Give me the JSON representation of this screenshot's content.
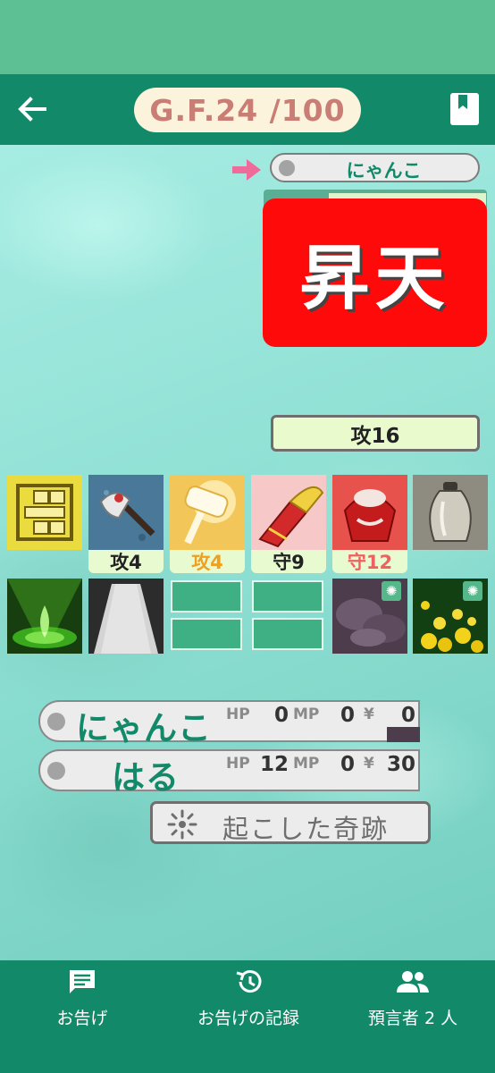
{
  "header": {
    "gf_counter": "G.F.24 /100",
    "back_icon": "arrow-left-icon",
    "bookmark_icon": "bookmark-icon"
  },
  "opponent": {
    "name": "にゃんこ",
    "status_banner": "昇天",
    "attack_total": "攻16"
  },
  "card_row_1": [
    {
      "icon": "grid-block-icon",
      "stat": ""
    },
    {
      "icon": "battle-axe-icon",
      "stat": "攻4",
      "stat_color": "#222222"
    },
    {
      "icon": "golden-hammer-icon",
      "stat": "攻4",
      "stat_color": "#f0a020"
    },
    {
      "icon": "gauntlet-icon",
      "stat": "守9",
      "stat_color": "#222222"
    },
    {
      "icon": "red-armor-icon",
      "stat": "守12",
      "stat_color": "#f06060"
    },
    {
      "icon": "urn-icon",
      "stat": ""
    }
  ],
  "card_row_2": [
    {
      "icon": "green-flame-icon"
    },
    {
      "icon": "stone-path-icon"
    },
    {
      "icon": "empty-slot"
    },
    {
      "icon": "empty-slot"
    },
    {
      "icon": "purple-cloud-icon",
      "badge": "sparkle-icon"
    },
    {
      "icon": "gold-coins-icon",
      "badge": "sparkle-icon"
    }
  ],
  "players": [
    {
      "name": "にゃんこ",
      "hp_label": "HP",
      "hp": "0",
      "mp_label": "MP",
      "mp": "0",
      "yen_label": "¥",
      "yen": "0"
    },
    {
      "name": "はる",
      "hp_label": "HP",
      "hp": "12",
      "mp_label": "MP",
      "mp": "0",
      "yen_label": "¥",
      "yen": "30"
    }
  ],
  "miracle_button": {
    "label": "起こした奇跡",
    "icon": "sparkle-icon"
  },
  "tabs": [
    {
      "label": "お告げ",
      "icon": "message-icon"
    },
    {
      "label": "お告げの記録",
      "icon": "history-icon"
    },
    {
      "label": "預言者 2 人",
      "icon": "people-icon"
    }
  ],
  "colors": {
    "header": "#128a6a",
    "accent_green": "#5dbf94",
    "banner_red": "#ff0a0a",
    "counter_text": "#c97d74"
  }
}
